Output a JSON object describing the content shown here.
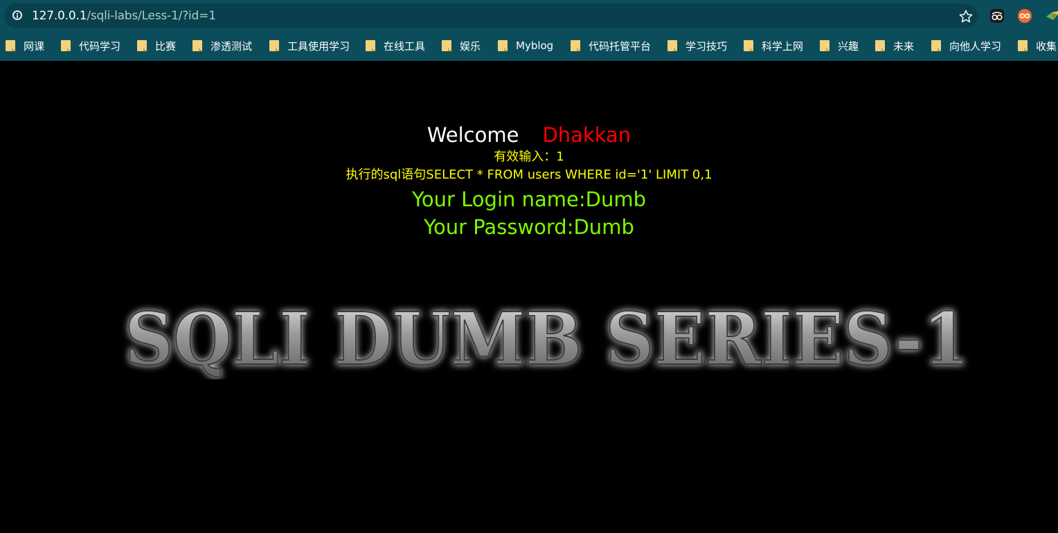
{
  "browser": {
    "url_host": "127.0.0.1",
    "url_path": "/sqli-labs/Less-1/?id=1"
  },
  "bookmarks": [
    "网课",
    "代码学习",
    "比赛",
    "渗透测试",
    "工具使用学习",
    "在线工具",
    "娱乐",
    "Myblog",
    "代码托管平台",
    "学习技巧",
    "科学上网",
    "兴趣",
    "未来",
    "向他人学习",
    "收集"
  ],
  "page": {
    "welcome_word": "Welcome",
    "welcome_user": "Dhakkan",
    "valid_input": "有效输入：1",
    "sql_statement": "执行的sql语句SELECT * FROM users WHERE id='1' LIMIT 0,1",
    "login_name": "Your Login name:Dumb",
    "password": "Your Password:Dumb",
    "banner_text": "SQLI DUMB SERIES-1"
  },
  "colors": {
    "chrome": "#0c4d5c",
    "page_background": "#000000",
    "welcome_user": "#ff0000",
    "sql_info": "#ffff00",
    "credentials": "#7cfc00"
  },
  "icons": [
    "info-icon",
    "star-icon",
    "extension-icon",
    "folder-icon"
  ]
}
